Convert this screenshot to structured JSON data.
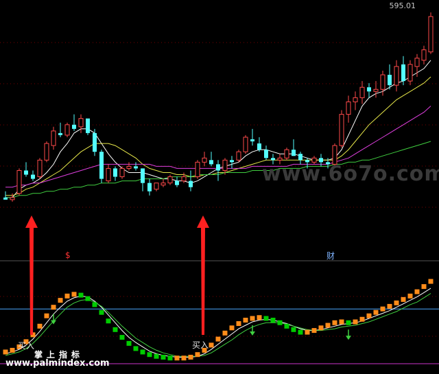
{
  "price_label": "595.01",
  "watermark": "www.6o7o.com",
  "sub_labels": {
    "left": "$",
    "right": "财"
  },
  "buy_labels": [
    "买入",
    "买入"
  ],
  "brand": "掌上指标",
  "site": "www.palmindex.com",
  "colors": {
    "up": "#ff4a4a",
    "down": "#54ffff",
    "ma5": "#ffffff",
    "ma10": "#e8e84a",
    "ma20": "#e040e0",
    "ma60": "#40d040",
    "grid": "#7a0000",
    "osc_up": "#ff8c1a",
    "osc_down": "#00cc00",
    "arrow": "#ff2020",
    "level": "#4aa8ff",
    "base": "#cc33cc"
  },
  "chart_data": [
    {
      "type": "candlestick",
      "title": "",
      "ohlc": [
        [
          44,
          47,
          43,
          43
        ],
        [
          43,
          46,
          42,
          44
        ],
        [
          46,
          58,
          45,
          57
        ],
        [
          57,
          61,
          54,
          55
        ],
        [
          55,
          57,
          52,
          53
        ],
        [
          54,
          63,
          53,
          62
        ],
        [
          62,
          71,
          61,
          70
        ],
        [
          69,
          78,
          67,
          76
        ],
        [
          75,
          80,
          73,
          74
        ],
        [
          74,
          80,
          73,
          79
        ],
        [
          79,
          84,
          76,
          77
        ],
        [
          78,
          84,
          75,
          82
        ],
        [
          82,
          81,
          74,
          75
        ],
        [
          75,
          77,
          64,
          66
        ],
        [
          66,
          67,
          51,
          53
        ],
        [
          52,
          60,
          51,
          58
        ],
        [
          58,
          59,
          52,
          54
        ],
        [
          54,
          59,
          53,
          58
        ],
        [
          58,
          61,
          57,
          59
        ],
        [
          59,
          61,
          57,
          58
        ],
        [
          58,
          58,
          47,
          51
        ],
        [
          51,
          53,
          45,
          47
        ],
        [
          48,
          51,
          47,
          51
        ],
        [
          50,
          53,
          49,
          51
        ],
        [
          51,
          55,
          50,
          54
        ],
        [
          52,
          54,
          49,
          50
        ],
        [
          52,
          56,
          51,
          54
        ],
        [
          52,
          57,
          47,
          49
        ],
        [
          54,
          62,
          53,
          61
        ],
        [
          61,
          66,
          59,
          63
        ],
        [
          62,
          66,
          59,
          60
        ],
        [
          60,
          62,
          52,
          57
        ],
        [
          57,
          63,
          55,
          62
        ],
        [
          62,
          64,
          58,
          61
        ],
        [
          62,
          67,
          61,
          66
        ],
        [
          66,
          74,
          65,
          73
        ],
        [
          72,
          77,
          69,
          71
        ],
        [
          70,
          73,
          66,
          67
        ],
        [
          67,
          69,
          62,
          63
        ],
        [
          63,
          65,
          60,
          62
        ],
        [
          62,
          65,
          60,
          63
        ],
        [
          63,
          68,
          62,
          67
        ],
        [
          67,
          72,
          64,
          64
        ],
        [
          65,
          66,
          60,
          62
        ],
        [
          62,
          63,
          58,
          61
        ],
        [
          61,
          64,
          60,
          63
        ],
        [
          63,
          65,
          59,
          61
        ],
        [
          61,
          63,
          58,
          60
        ],
        [
          60,
          70,
          59,
          69
        ],
        [
          69,
          86,
          68,
          84
        ],
        [
          84,
          93,
          80,
          90
        ],
        [
          90,
          95,
          86,
          92
        ],
        [
          92,
          100,
          89,
          97
        ],
        [
          97,
          99,
          92,
          95
        ],
        [
          95,
          100,
          92,
          96
        ],
        [
          96,
          105,
          93,
          103
        ],
        [
          103,
          108,
          96,
          98
        ],
        [
          98,
          110,
          95,
          107
        ],
        [
          108,
          112,
          98,
          100
        ],
        [
          100,
          110,
          98,
          108
        ],
        [
          107,
          113,
          102,
          111
        ],
        [
          110,
          117,
          108,
          115
        ],
        [
          114,
          133,
          113,
          131
        ]
      ],
      "moving_averages": [
        {
          "name": "",
          "color": "#ffffff",
          "values": [
            44,
            44,
            48,
            50,
            51,
            53,
            56,
            60,
            66,
            70,
            75,
            77,
            77,
            75,
            70,
            65,
            61,
            58,
            56,
            56,
            56,
            55,
            54,
            53,
            53,
            52,
            52,
            51,
            52,
            54,
            56,
            58,
            59,
            60,
            61,
            64,
            66,
            67,
            67,
            66,
            65,
            65,
            65,
            64,
            63,
            62,
            62,
            62,
            63,
            67,
            74,
            81,
            88,
            92,
            94,
            95,
            97,
            99,
            100,
            102,
            104,
            106,
            110
          ]
        },
        {
          "name": "",
          "color": "#e8e84a",
          "values": [
            45,
            45,
            46,
            48,
            49,
            51,
            53,
            55,
            57,
            60,
            63,
            66,
            68,
            70,
            70,
            70,
            69,
            67,
            65,
            63,
            60,
            58,
            57,
            56,
            56,
            55,
            55,
            54,
            54,
            55,
            55,
            56,
            56,
            57,
            58,
            59,
            60,
            61,
            62,
            62,
            62,
            62,
            62,
            62,
            62,
            62,
            62,
            62,
            62,
            64,
            67,
            71,
            75,
            79,
            82,
            85,
            88,
            91,
            93,
            95,
            97,
            99,
            102
          ]
        },
        {
          "name": "",
          "color": "#e040e0",
          "values": [
            49,
            49,
            50,
            50,
            51,
            51,
            52,
            53,
            54,
            55,
            56,
            57,
            58,
            59,
            60,
            60,
            60,
            60,
            60,
            60,
            60,
            60,
            59,
            59,
            59,
            58,
            58,
            58,
            58,
            58,
            58,
            58,
            58,
            58,
            58,
            58,
            59,
            59,
            59,
            59,
            59,
            59,
            60,
            60,
            60,
            60,
            60,
            60,
            61,
            62,
            63,
            65,
            67,
            69,
            71,
            73,
            75,
            77,
            79,
            81,
            83,
            85,
            88
          ]
        },
        {
          "name": "",
          "color": "#40d040",
          "values": [
            44,
            44,
            45,
            45,
            46,
            46,
            47,
            47,
            48,
            48,
            49,
            49,
            50,
            50,
            51,
            51,
            51,
            52,
            52,
            52,
            53,
            53,
            53,
            53,
            54,
            54,
            54,
            54,
            55,
            55,
            55,
            55,
            56,
            56,
            56,
            56,
            57,
            57,
            57,
            57,
            58,
            58,
            58,
            58,
            59,
            59,
            59,
            59,
            60,
            60,
            61,
            61,
            62,
            62,
            63,
            64,
            65,
            66,
            67,
            68,
            69,
            70,
            71
          ]
        }
      ],
      "ylim": [
        40,
        135
      ],
      "last_price": "595.01"
    },
    {
      "type": "line",
      "title": "",
      "oscillator": [
        10,
        12,
        16,
        22,
        30,
        40,
        52,
        62,
        70,
        75,
        77,
        76,
        72,
        65,
        56,
        46,
        36,
        27,
        20,
        14,
        10,
        7,
        5,
        4,
        3,
        3,
        3,
        4,
        7,
        12,
        18,
        25,
        32,
        38,
        43,
        47,
        49,
        50,
        49,
        47,
        44,
        40,
        36,
        33,
        33,
        35,
        38,
        41,
        44,
        45,
        44,
        45,
        48,
        52,
        56,
        60,
        63,
        67,
        71,
        75,
        80,
        86,
        92
      ],
      "signal_a": [
        8,
        10,
        13,
        18,
        25,
        34,
        44,
        54,
        62,
        69,
        73,
        75,
        74,
        69,
        62,
        53,
        44,
        35,
        27,
        21,
        16,
        11,
        8,
        6,
        5,
        4,
        4,
        4,
        5,
        8,
        13,
        19,
        25,
        31,
        37,
        41,
        45,
        47,
        48,
        47,
        45,
        43,
        40,
        37,
        35,
        35,
        36,
        38,
        40,
        42,
        43,
        44,
        46,
        49,
        52,
        55,
        58,
        62,
        66,
        70,
        74,
        79,
        84
      ],
      "signal_b": [
        6,
        8,
        10,
        14,
        20,
        28,
        37,
        46,
        54,
        62,
        67,
        70,
        71,
        68,
        63,
        56,
        48,
        40,
        33,
        26,
        21,
        16,
        12,
        9,
        7,
        5,
        5,
        5,
        5,
        6,
        9,
        14,
        19,
        24,
        30,
        35,
        39,
        42,
        44,
        44,
        44,
        42,
        40,
        38,
        36,
        35,
        35,
        36,
        37,
        39,
        40,
        41,
        43,
        45,
        48,
        51,
        54,
        57,
        61,
        65,
        68,
        73,
        78
      ],
      "buy_points": [
        3,
        28
      ],
      "down_arrows": [
        7,
        36,
        50
      ],
      "level_lines": [
        60,
        0
      ],
      "ylim": [
        -2,
        100
      ]
    }
  ]
}
